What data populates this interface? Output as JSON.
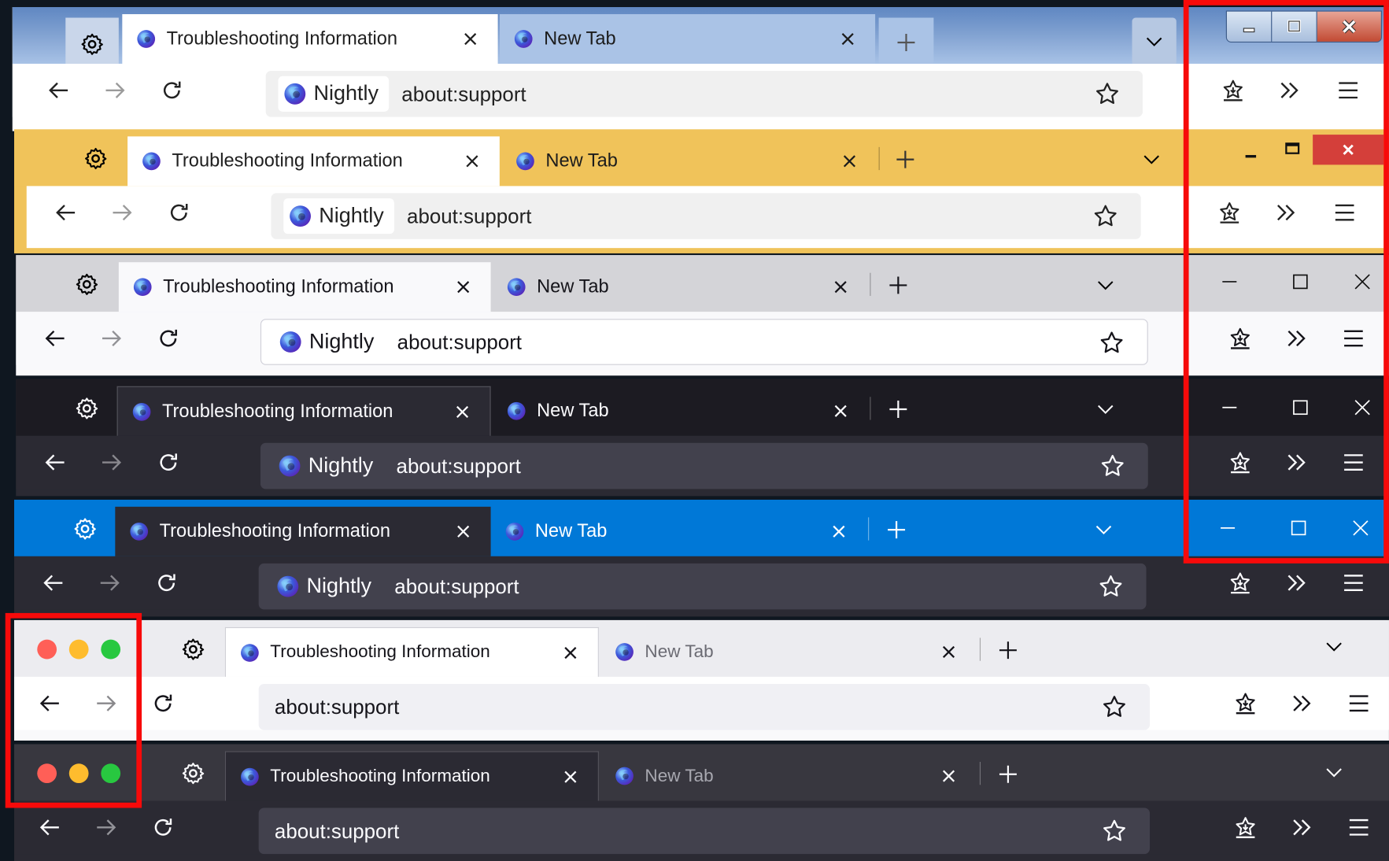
{
  "tabs": {
    "active_title": "Troubleshooting Information",
    "inactive_title": "New Tab"
  },
  "urlbar": {
    "identity_label": "Nightly",
    "address": "about:support"
  },
  "theme_rows": [
    {
      "name": "windows-7-classic"
    },
    {
      "name": "windows-8-yellow"
    },
    {
      "name": "windows-10-light"
    },
    {
      "name": "windows-10-dark"
    },
    {
      "name": "windows-10-accent"
    },
    {
      "name": "macos-light"
    },
    {
      "name": "macos-dark"
    }
  ],
  "icons": {
    "settings": "gear-icon",
    "favicon": "firefox-nightly-icon",
    "close_tab": "close-icon",
    "new_tab": "plus-icon",
    "list_all_tabs": "chevron-down-icon",
    "back": "arrow-left-icon",
    "forward": "arrow-right-icon",
    "reload": "reload-icon",
    "bookmark": "star-icon",
    "save_to_pocket": "pocket-icon",
    "overflow": "double-chevron-icon",
    "menu": "hamburger-icon",
    "minimize": "minimize-icon",
    "maximize": "maximize-icon",
    "close_window": "close-window-icon"
  },
  "colors": {
    "highlight_box": "#f70a0a",
    "win8_titlebar": "#f0c35a",
    "win10_accent": "#0078d7",
    "close_red": "#e81123",
    "mac_close": "#ff5f57",
    "mac_minimize": "#febc2e",
    "mac_zoom": "#28c840"
  }
}
